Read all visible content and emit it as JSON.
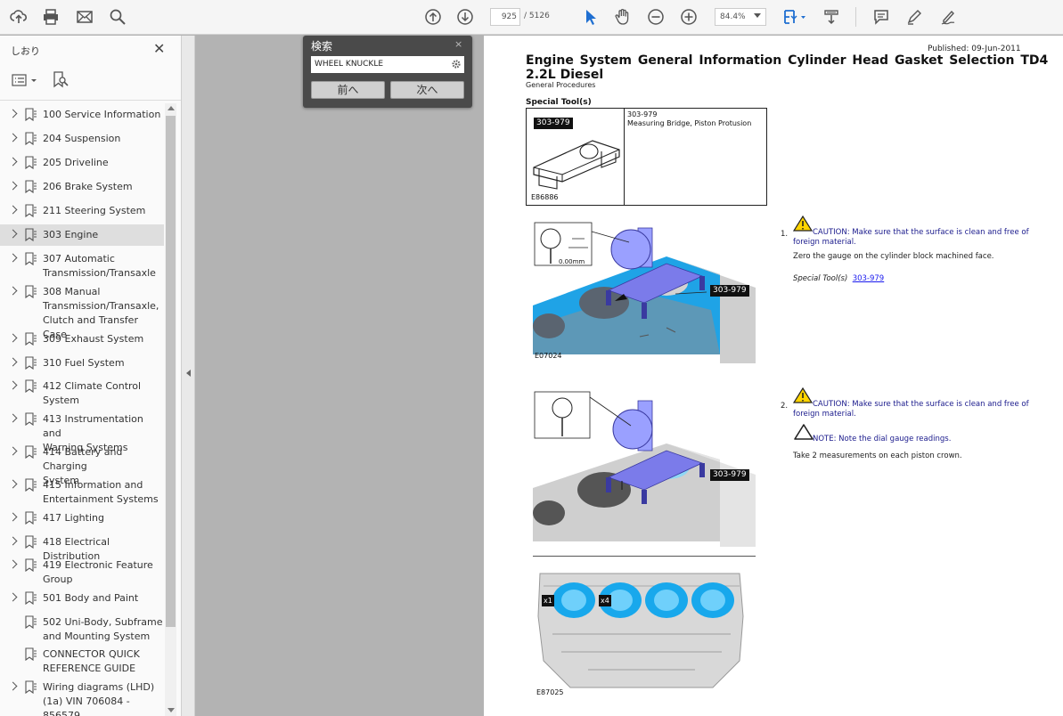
{
  "toolbar": {
    "page_current": "925",
    "page_total": "/ 5126",
    "zoom": "84.4%"
  },
  "sidebar": {
    "title": "しおり",
    "close": "✕",
    "items": [
      {
        "label": "100 Service Information",
        "expandable": true
      },
      {
        "label": "204 Suspension",
        "expandable": true
      },
      {
        "label": "205 Driveline",
        "expandable": true
      },
      {
        "label": "206 Brake System",
        "expandable": true
      },
      {
        "label": "211 Steering System",
        "expandable": true
      },
      {
        "label": "303 Engine",
        "expandable": true,
        "selected": true
      },
      {
        "label": "307 Automatic\nTransmission/Transaxle",
        "expandable": true
      },
      {
        "label": "308 Manual\nTransmission/Transaxle,\nClutch and Transfer Case",
        "expandable": true
      },
      {
        "label": "309 Exhaust System",
        "expandable": true
      },
      {
        "label": "310 Fuel System",
        "expandable": true
      },
      {
        "label": "412 Climate Control\nSystem",
        "expandable": true
      },
      {
        "label": "413 Instrumentation and\nWarning Systems",
        "expandable": true
      },
      {
        "label": "414 Battery and Charging\nSystem",
        "expandable": true
      },
      {
        "label": "415 Information and\nEntertainment Systems",
        "expandable": true
      },
      {
        "label": "417 Lighting",
        "expandable": true
      },
      {
        "label": "418 Electrical Distribution",
        "expandable": true
      },
      {
        "label": "419 Electronic Feature\nGroup",
        "expandable": true
      },
      {
        "label": "501 Body and Paint",
        "expandable": true
      },
      {
        "label": "502 Uni-Body, Subframe\nand Mounting System",
        "expandable": false
      },
      {
        "label": "CONNECTOR QUICK\nREFERENCE GUIDE",
        "expandable": false
      },
      {
        "label": "Wiring diagrams (LHD)\n(1a) VIN 706084 - 856579",
        "expandable": true
      }
    ]
  },
  "search": {
    "title": "検索",
    "close": "×",
    "query": "WHEEL KNUCKLE",
    "prev_label": "前へ",
    "next_label": "次へ"
  },
  "document": {
    "published": "Published: 09-Jun-2011",
    "title_line1": "Engine System    General Information    Cylinder Head Gasket Selection TD4",
    "title_line2": "2.2L Diesel",
    "section": "General Procedures",
    "special_tools_heading": "Special Tool(s)",
    "tool_label": "303-979",
    "tool_code": "E86886",
    "tool_desc_line1": "303-979",
    "tool_desc_line2": "Measuring Bridge, Piston Protusion",
    "fig1_label": "303-979",
    "fig1_code": "E07024",
    "fig1_dial": "0.00mm",
    "fig2_label": "303-979",
    "fig3_code": "E87025",
    "fig3_x1": "x1",
    "fig3_x4": "x4",
    "step1": {
      "num": "1.",
      "caution": "CAUTION: Make sure that the surface is clean and free of foreign material.",
      "body": "Zero the gauge on the cylinder block machined face.",
      "tools_prefix": "Special Tool(s)",
      "tools_link": "303-979"
    },
    "step2": {
      "num": "2.",
      "caution": "CAUTION: Make sure that the surface is clean and free of foreign material.",
      "note": "NOTE: Note the dial gauge readings.",
      "body": "Take 2 measurements on each piston crown."
    }
  }
}
